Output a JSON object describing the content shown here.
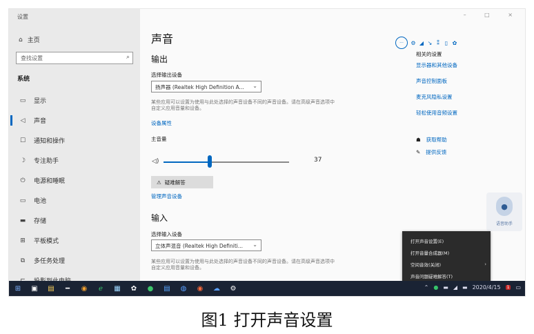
{
  "window": {
    "title": "设置",
    "controls": "–  □  ×"
  },
  "sidebar": {
    "home": "主页",
    "search_placeholder": "查找设置",
    "section": "系统",
    "items": [
      {
        "icon": "display-icon",
        "glyph": "▭",
        "label": "显示"
      },
      {
        "icon": "sound-icon",
        "glyph": "◁",
        "label": "声音"
      },
      {
        "icon": "notifications-icon",
        "glyph": "☐",
        "label": "通知和操作"
      },
      {
        "icon": "focus-assist-icon",
        "glyph": "☽",
        "label": "专注助手"
      },
      {
        "icon": "power-icon",
        "glyph": "⏻",
        "label": "电源和睡眠"
      },
      {
        "icon": "battery-icon",
        "glyph": "▭",
        "label": "电池"
      },
      {
        "icon": "storage-icon",
        "glyph": "▬",
        "label": "存储"
      },
      {
        "icon": "tablet-mode-icon",
        "glyph": "⊞",
        "label": "平板模式"
      },
      {
        "icon": "multitasking-icon",
        "glyph": "⧉",
        "label": "多任务处理"
      },
      {
        "icon": "project-icon",
        "glyph": "⊏",
        "label": "投影到此电脑"
      }
    ]
  },
  "main": {
    "title": "声音",
    "output": {
      "heading": "输出",
      "device_label": "选择输出设备",
      "device_value": "扬声器 (Realtek High Definition A...",
      "description": "某些应用可以设置为使用与此处选择的声音设备不同的声音设备。请在高级声音选项中自定义应用音量和设备。",
      "properties_link": "设备属性",
      "volume_label": "主音量",
      "volume_value": "37",
      "troubleshoot": "疑难解答",
      "manage_link": "管理声音设备"
    },
    "input": {
      "heading": "输入",
      "device_label": "选择输入设备",
      "device_value": "立体声混音 (Realtek High Definiti...",
      "description": "某些应用可以设置为使用与此处选择的声音设备不同的声音设备。请在高级声音选项中自定义应用音量和设备。"
    },
    "related": {
      "title": "相关的设置",
      "links": [
        "显示器和其他设备",
        "声音控制面板",
        "麦克风隐私设置",
        "轻松使用音频设置"
      ]
    },
    "help": {
      "get_help": "获取帮助",
      "feedback": "提供反馈"
    },
    "mic_helper_label": "语音助手"
  },
  "context_menu": {
    "items": [
      "打开声音设置(E)",
      "打开音量合成器(M)",
      "空间音效(关闭)",
      "声音问题疑难解答(T)"
    ]
  },
  "taskbar": {
    "time": "2020/4/15",
    "badge": "1"
  },
  "caption": "图1   打开声音设置",
  "volume_level": 0.37,
  "colors": {
    "accent": "#0067c0",
    "taskbar": "#1a2334",
    "sidebar": "#eaeaea"
  }
}
